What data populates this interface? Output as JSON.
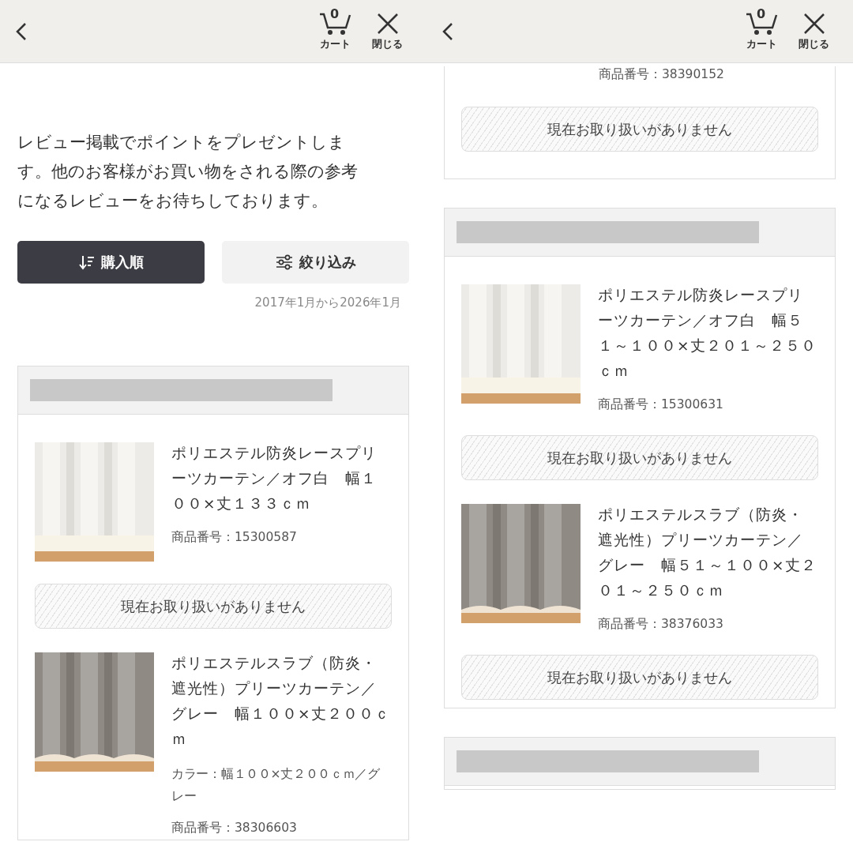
{
  "panels": [
    {
      "header": {
        "cart_count": "0",
        "cart_label": "カート",
        "close_label": "閉じる"
      },
      "intro": "レビュー掲載でポイントをプレゼントします。他のお客様がお買い物をされる際の参考になるレビューをお待ちしております。",
      "sort_buttons": [
        {
          "label": "購入順",
          "kind": "sort",
          "selected": true
        },
        {
          "label": "絞り込み",
          "kind": "filter",
          "selected": false
        }
      ],
      "date_range": "2017年1月から2026年1月",
      "cards": [
        {
          "kind": "order",
          "items": [
            {
              "kind": "full",
              "title": "ポリエステル防炎レースプリーツカーテン／オフ白　幅１００×丈１３３ｃｍ",
              "product_code": "商品番号：15300587",
              "status": "現在お取り扱いがありません"
            },
            {
              "kind": "full",
              "title": "ポリエステルスラブ（防炎・遮光性）プリーツカーテン／グレー　幅１００×丈２００ｃｍ",
              "variant": "カラー：幅１００×丈２００ｃｍ／グレー",
              "product_code": "商品番号：38306603"
            }
          ]
        }
      ]
    },
    {
      "header": {
        "cart_count": "0",
        "cart_label": "カート",
        "close_label": "閉じる"
      },
      "cards": [
        {
          "kind": "continued",
          "items": [
            {
              "kind": "partial",
              "product_code": "商品番号：38390152",
              "status": "現在お取り扱いがありません"
            }
          ]
        },
        {
          "kind": "order",
          "items": [
            {
              "kind": "full",
              "title": "ポリエステル防炎レースプリーツカーテン／オフ白　幅５１～１００×丈２０１～２５０ｃｍ",
              "product_code": "商品番号：15300631",
              "status": "現在お取り扱いがありません"
            },
            {
              "kind": "full",
              "title": "ポリエステルスラブ（防炎・遮光性）プリーツカーテン／グレー　幅５１～１００×丈２０１～２５０ｃｍ",
              "product_code": "商品番号：38376033",
              "status": "現在お取り扱いがありません"
            }
          ]
        },
        {
          "kind": "order"
        }
      ]
    }
  ]
}
